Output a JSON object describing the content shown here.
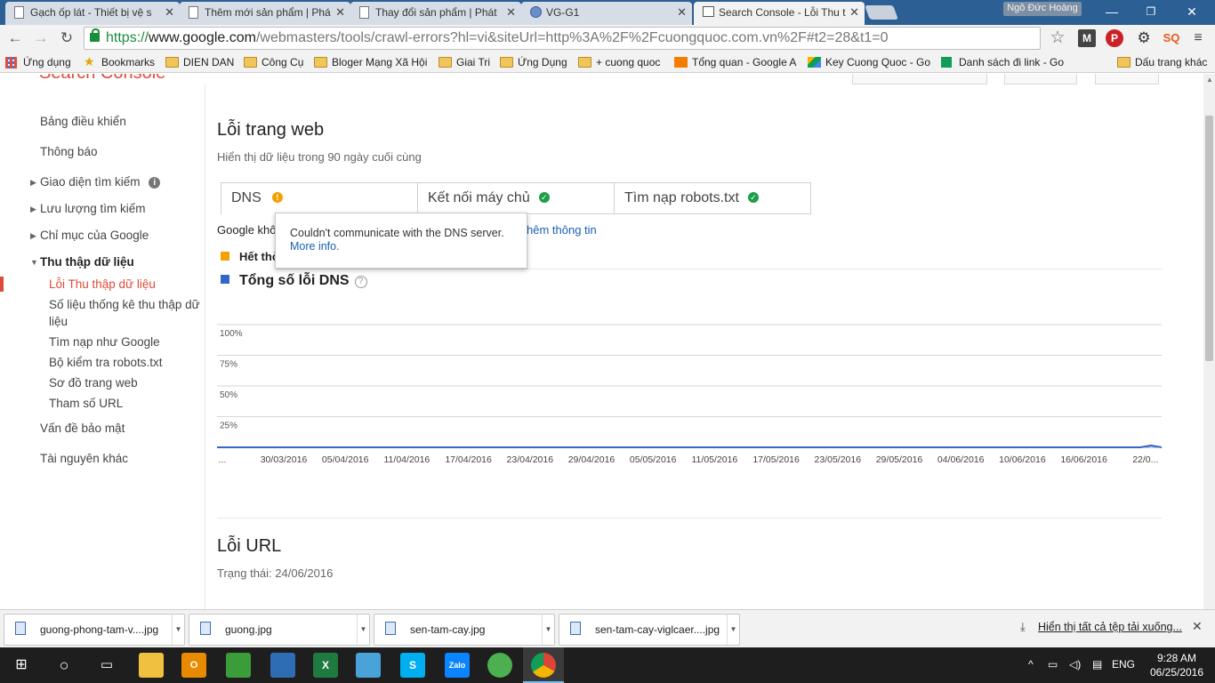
{
  "browser": {
    "tabs": [
      {
        "title": "Gạch ốp lát - Thiết bị vệ s"
      },
      {
        "title": "Thêm mới sản phẩm | Phá"
      },
      {
        "title": "Thay đổi sản phẩm | Phát"
      },
      {
        "title": "VG-G1"
      },
      {
        "title": "Search Console - Lỗi Thu t"
      }
    ],
    "profile_name": "Ngô Đức Hoàng",
    "url_scheme": "https://",
    "url_host": "www.google.com",
    "url_rest": "/webmasters/tools/crawl-errors?hl=vi&siteUrl=http%3A%2F%2Fcuongquoc.com.vn%2F#t2=28&t1=0",
    "bookmarks": [
      {
        "label": "Ứng dụng",
        "icon": "apps-grid-icon"
      },
      {
        "label": "Bookmarks",
        "icon": "star-icon"
      },
      {
        "label": "DIEN DAN",
        "icon": "folder-icon"
      },
      {
        "label": "Công Cụ",
        "icon": "folder-icon"
      },
      {
        "label": "Bloger Mạng Xã Hội",
        "icon": "folder-icon"
      },
      {
        "label": "Giai Tri",
        "icon": "folder-icon"
      },
      {
        "label": "Ứng Dụng",
        "icon": "folder-icon"
      },
      {
        "label": "+ cuong quoc",
        "icon": "folder-icon"
      },
      {
        "label": "Tổng quan - Google A",
        "icon": "analytics-icon"
      },
      {
        "label": "Key Cuong Quoc - Go",
        "icon": "drive-icon"
      },
      {
        "label": "Danh sách đi link - Go",
        "icon": "sheets-icon"
      },
      {
        "label": "Dấu trang khác",
        "icon": "folder-icon"
      }
    ]
  },
  "sidebar": {
    "items": [
      {
        "label": "Bảng điều khiển"
      },
      {
        "label": "Thông báo"
      },
      {
        "label": "Giao diện tìm kiếm"
      },
      {
        "label": "Lưu lượng tìm kiếm"
      },
      {
        "label": "Chỉ mục của Google"
      },
      {
        "label": "Thu thập dữ liệu"
      },
      {
        "label": "Lỗi Thu thập dữ liệu"
      },
      {
        "label": "Số liệu thống kê thu thập dữ"
      },
      {
        "label": "liệu"
      },
      {
        "label": "Tìm nạp như Google"
      },
      {
        "label": "Bộ kiểm tra robots.txt"
      },
      {
        "label": "Sơ đồ trang web"
      },
      {
        "label": "Tham số URL"
      },
      {
        "label": "Vấn đề bảo mật"
      },
      {
        "label": "Tài nguyên khác"
      }
    ]
  },
  "main": {
    "title": "Lỗi trang web",
    "subtitle": "Hiển thị dữ liệu trong 90 ngày cuối cùng",
    "tabs": [
      {
        "label": "DNS",
        "status": "warning"
      },
      {
        "label": "Kết nối máy chủ",
        "status": "ok"
      },
      {
        "label": "Tìm nạp robots.txt",
        "status": "ok"
      }
    ],
    "desc_visible": "Google khô",
    "more_link": "hêm thông tin",
    "legend_visible": "Hết thờ",
    "chart_title": "Tổng số lỗi DNS",
    "tooltip_text": "Couldn't communicate with the DNS server.",
    "tooltip_link": "More info.",
    "url_errors_title": "Lỗi URL",
    "status_line": "Trạng thái: 24/06/2016"
  },
  "chart_data": {
    "type": "line",
    "title": "Tổng số lỗi DNS",
    "y_tick_labels": [
      "100%",
      "75%",
      "50%",
      "25%"
    ],
    "ylim": [
      0,
      100
    ],
    "x_tick_labels": [
      "...",
      "30/03/2016",
      "05/04/2016",
      "11/04/2016",
      "17/04/2016",
      "23/04/2016",
      "29/04/2016",
      "05/05/2016",
      "11/05/2016",
      "17/05/2016",
      "23/05/2016",
      "29/05/2016",
      "04/06/2016",
      "10/06/2016",
      "16/06/2016",
      "22/0..."
    ],
    "series": [
      {
        "name": "Tổng số lỗi DNS",
        "color": "#3366cc",
        "values": [
          0,
          0,
          0,
          0,
          0,
          0,
          0,
          0,
          0,
          0,
          0,
          0,
          0,
          0,
          0,
          0,
          0,
          0,
          0,
          0,
          0,
          0,
          0,
          0,
          0,
          0,
          0,
          0,
          0,
          0,
          0,
          0,
          0,
          0,
          0,
          0,
          0,
          0,
          0,
          0,
          0,
          0,
          0,
          0,
          0,
          0,
          0,
          0,
          0,
          0,
          0,
          0,
          0,
          0,
          0,
          0,
          0,
          0,
          0,
          0,
          0,
          0,
          0,
          0,
          0,
          0,
          0,
          0,
          0,
          0,
          0,
          0,
          0,
          0,
          0,
          0,
          0,
          0,
          0,
          0,
          0,
          0,
          0,
          0,
          0,
          0,
          0,
          0,
          1.5,
          0
        ]
      }
    ],
    "grid": true
  },
  "downloads": {
    "items": [
      {
        "name": "guong-phong-tam-v....jpg"
      },
      {
        "name": "guong.jpg"
      },
      {
        "name": "sen-tam-cay.jpg"
      },
      {
        "name": "sen-tam-cay-viglcaer....jpg"
      }
    ],
    "show_all": "Hiển thị tất cả tệp tải xuống..."
  },
  "taskbar": {
    "lang": "ENG",
    "time": "9:28 AM",
    "date": "06/25/2016"
  },
  "colors": {
    "accent": "#dd4b39",
    "warning": "#f4a100",
    "ok": "#1e9e4a",
    "series": "#3366cc",
    "link": "#1a5fb4"
  }
}
